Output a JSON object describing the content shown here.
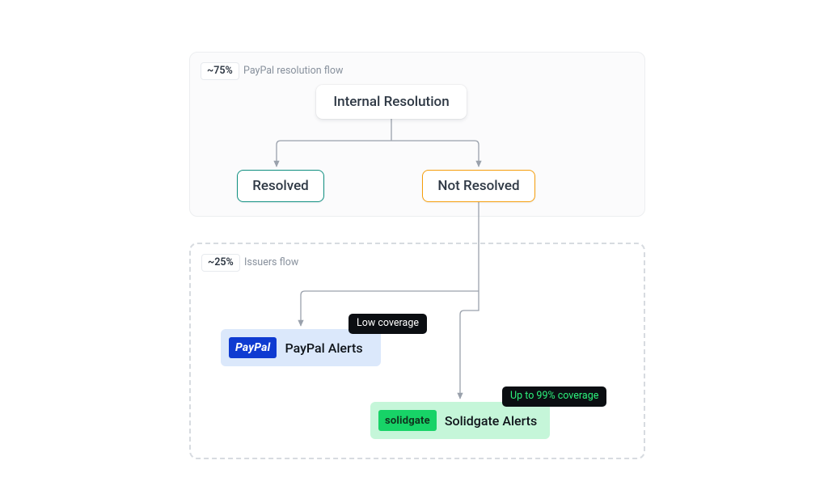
{
  "panels": {
    "top": {
      "percent": "~75%",
      "label": "PayPal resolution flow"
    },
    "bottom": {
      "percent": "~25%",
      "label": "Issuers flow"
    }
  },
  "nodes": {
    "root": "Internal Resolution",
    "resolved": "Resolved",
    "notResolved": "Not Resolved"
  },
  "alerts": {
    "paypal": {
      "brand": "PayPal",
      "label": "PayPal Alerts",
      "coverage": "Low coverage"
    },
    "solidgate": {
      "brand": "solidgate",
      "label": "Solidgate Alerts",
      "coverage": "Up to 99% coverage"
    }
  }
}
